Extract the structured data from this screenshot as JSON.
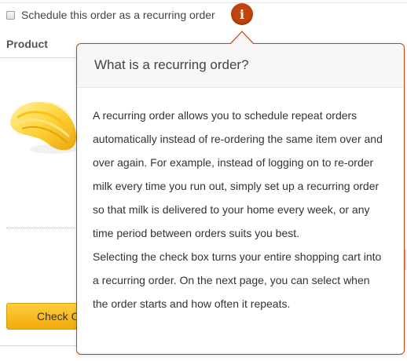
{
  "recurring": {
    "checkbox_checked": false,
    "label": "Schedule this order as a recurring order",
    "info_icon_glyph": "i"
  },
  "table": {
    "product_header": "Product"
  },
  "checkout": {
    "label": "Check Out"
  },
  "popover": {
    "title": "What is a recurring order?",
    "paragraph_1": "A recurring order allows you to schedule repeat orders automatically instead of re-ordering the same item over and over again. For example, instead of logging on to re-order milk every time you run out, simply set up a recurring order so that milk is delivered to your home every week, or any time period between orders suits you best.",
    "paragraph_2": "Selecting the check box turns your entire shopping cart into a recurring order. On the next page, you can select when the order starts and how often it repeats."
  },
  "colors": {
    "accent": "#c0440e",
    "button_fill": "#f7b624",
    "text": "#333333"
  },
  "icons": {
    "info": "info-icon",
    "checkbox": "checkbox-icon"
  }
}
